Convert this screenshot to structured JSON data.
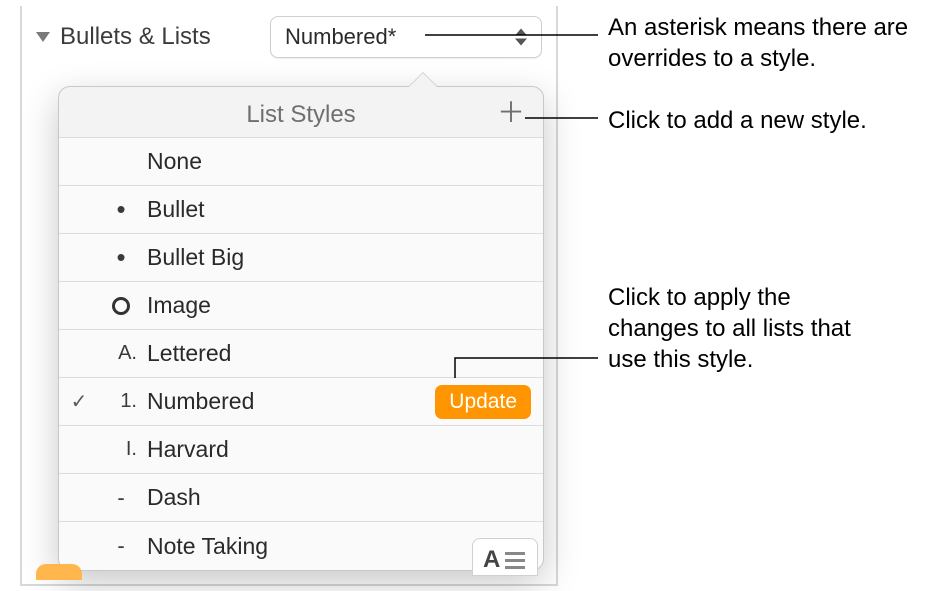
{
  "section": {
    "label": "Bullets & Lists"
  },
  "popupValue": "Numbered*",
  "popover": {
    "title": "List Styles",
    "addGlyph": "＋",
    "updateLabel": "Update",
    "items": [
      {
        "marker": "",
        "label": "None"
      },
      {
        "marker": "•",
        "label": "Bullet"
      },
      {
        "marker": "•",
        "label": "Bullet Big"
      },
      {
        "marker": "○",
        "label": "Image"
      },
      {
        "marker": "A.",
        "label": "Lettered"
      },
      {
        "marker": "1.",
        "label": "Numbered"
      },
      {
        "marker": "I.",
        "label": "Harvard"
      },
      {
        "marker": "-",
        "label": "Dash"
      },
      {
        "marker": "-",
        "label": "Note Taking"
      }
    ]
  },
  "callouts": {
    "asterisk": "An asterisk means there are overrides to a style.",
    "add": "Click to add a new style.",
    "update": "Click to apply the changes to all lists that use this style."
  },
  "checkGlyph": "✓"
}
